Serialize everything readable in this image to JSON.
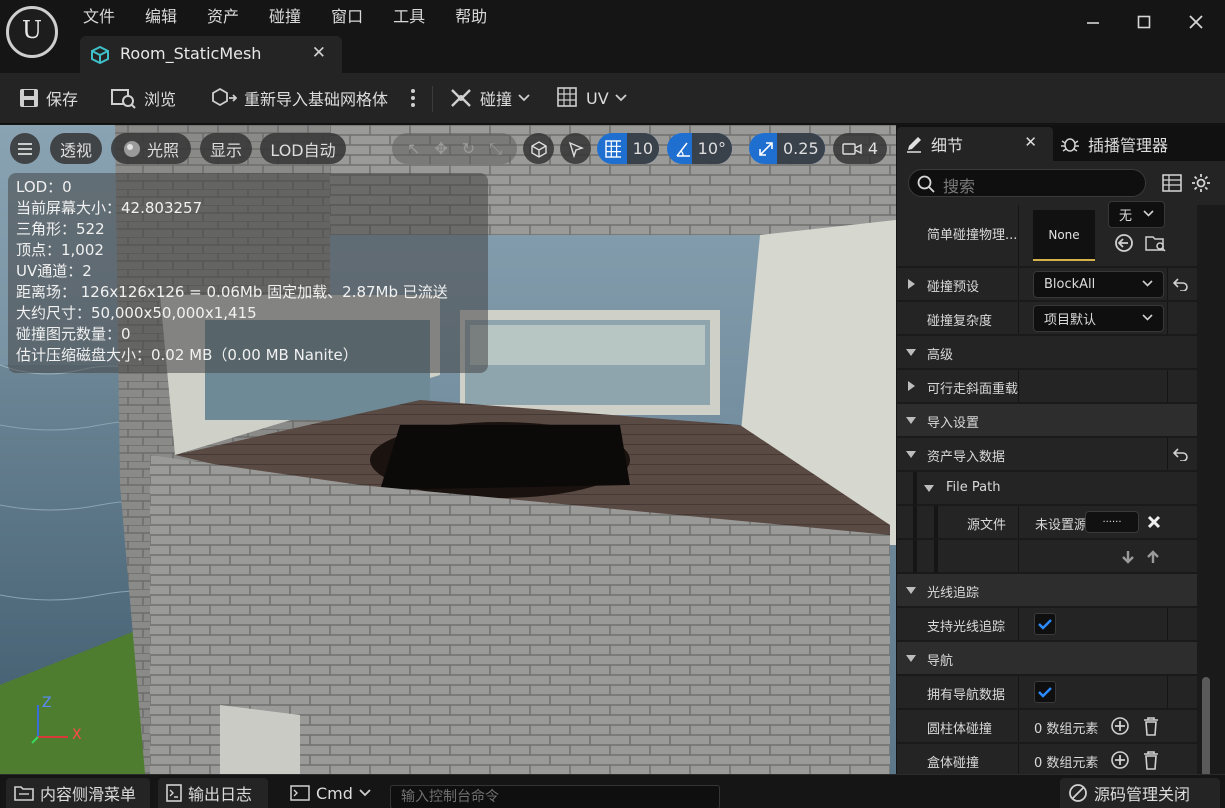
{
  "app": {
    "logo_text": "U",
    "menu": [
      "文件",
      "编辑",
      "资产",
      "碰撞",
      "窗口",
      "工具",
      "帮助"
    ],
    "document_tab": "Room_StaticMesh"
  },
  "toolbar": {
    "save": "保存",
    "browse": "浏览",
    "reimport": "重新导入基础网格体",
    "collision": "碰撞",
    "uv": "UV"
  },
  "viewport": {
    "buttons": {
      "perspective": "透视",
      "lighting": "光照",
      "show": "显示",
      "lod": "LOD自动",
      "grid_snap": "10",
      "rotate_snap": "10°",
      "scale_snap": "0.25",
      "camera_speed": "4"
    },
    "stats": [
      "LOD：0",
      "当前屏幕大小：42.803257",
      "三角形：522",
      "顶点：1,002",
      "UV通道：2",
      "距离场： 126x126x126 = 0.06Mb 固定加载、2.87Mb 已流送",
      "大约尺寸：50,000x50,000x1,415",
      "碰撞图元数量：0",
      "估计压缩磁盘大小：0.02 MB（0.00 MB Nanite）"
    ],
    "axis": {
      "z": "Z",
      "x": "X"
    }
  },
  "details": {
    "tab_details": "细节",
    "tab_plugins": "插播管理器",
    "search_placeholder": "搜索",
    "rows": {
      "simple_collision_label": "简单碰撞物理...",
      "simple_collision_value": "None",
      "simple_collision_combo": "无",
      "collision_preset_label": "碰撞预设",
      "collision_preset_value": "BlockAll",
      "collision_complexity_label": "碰撞复杂度",
      "collision_complexity_value": "项目默认",
      "advanced": "高级",
      "walkable_override": "可行走斜面重载",
      "import_settings": "导入设置",
      "asset_import_data": "资产导入数据",
      "file_path": "File Path",
      "source_file_label": "源文件",
      "source_file_value": "未设置源",
      "source_file_button": "......",
      "ray_tracing": "光线追踪",
      "support_ray_tracing": "支持光线追踪",
      "navigation": "导航",
      "has_nav_data": "拥有导航数据",
      "capsule_collision": "圆柱体碰撞",
      "capsule_value": "0 数组元素",
      "box_collision": "盒体碰撞",
      "box_value": "0 数组元素"
    }
  },
  "bottom": {
    "content_drawer": "内容侧滑菜单",
    "output_log": "输出日志",
    "cmd": "Cmd",
    "cmd_placeholder": "输入控制台命令",
    "source_control": "源码管理关闭"
  },
  "colors": {
    "accent_blue": "#1f6fd1",
    "panel_bg": "#242424",
    "titlebar_bg": "#151515"
  }
}
